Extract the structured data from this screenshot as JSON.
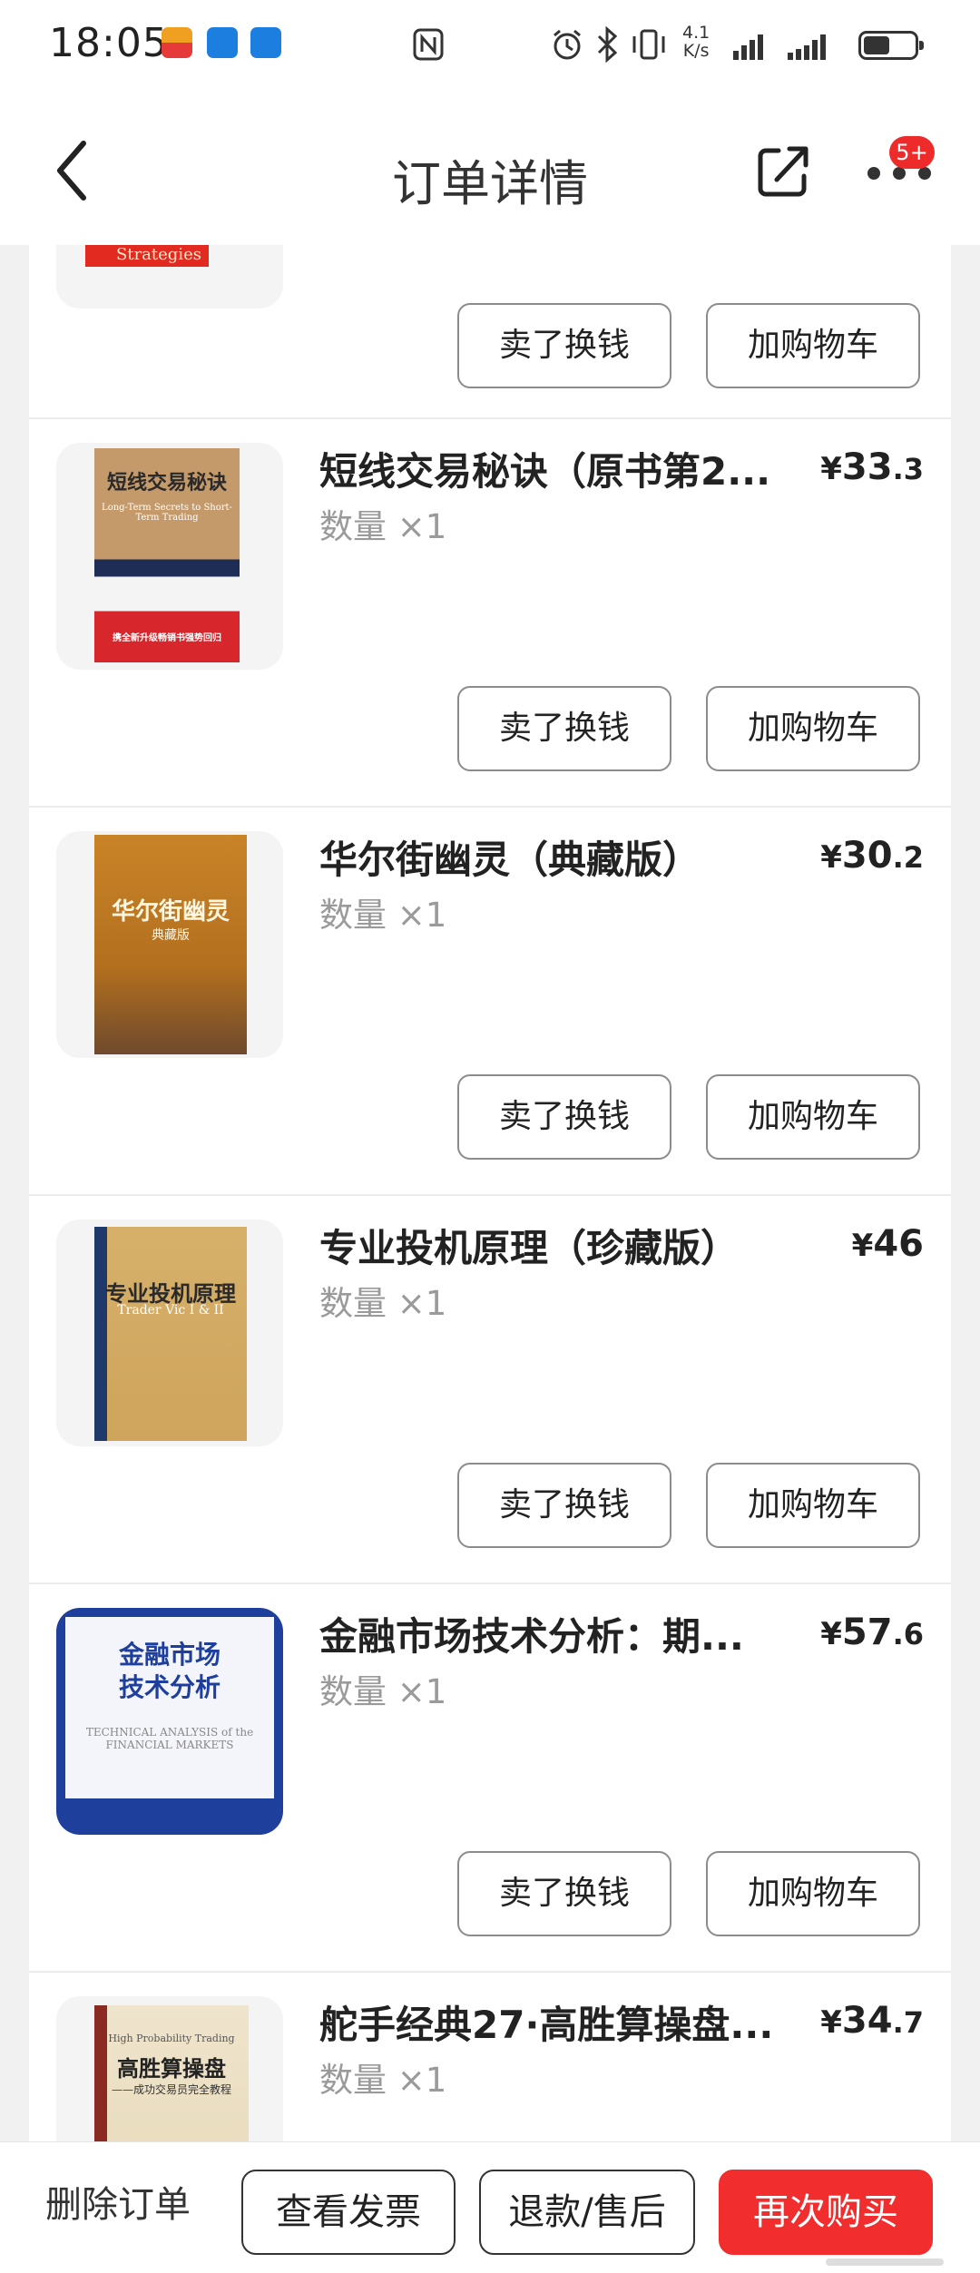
{
  "status_bar": {
    "time": "18:05",
    "network_speed_value": "4.1",
    "network_speed_unit": "K/s",
    "icons": [
      "app-notification-icon",
      "cloud-app-icon",
      "cloud-app-icon",
      "nfc-icon",
      "alarm-icon",
      "bluetooth-icon",
      "vibrate-icon",
      "signal-icon",
      "signal-icon",
      "battery-icon"
    ]
  },
  "nav": {
    "title": "订单详情",
    "badge": "5+"
  },
  "top_partial_item": {
    "cover_text": "Strategies",
    "sell_label": "卖了换钱",
    "cart_label": "加购物车"
  },
  "items": [
    {
      "title": "短线交易秘诀（原书第2...",
      "quantity": "数量 ×1",
      "price_symbol": "¥",
      "price_int": "33",
      "price_dec": ".3",
      "sell_label": "卖了换钱",
      "cart_label": "加购物车",
      "cover": {
        "title": "短线交易秘诀",
        "subtitle": "Long-Term Secrets to Short-Term Trading",
        "bottom": "携全新升级畅销书强势回归"
      }
    },
    {
      "title": "华尔街幽灵（典藏版）",
      "quantity": "数量 ×1",
      "price_symbol": "¥",
      "price_int": "30",
      "price_dec": ".2",
      "sell_label": "卖了换钱",
      "cart_label": "加购物车",
      "cover": {
        "title": "华尔街幽灵",
        "subtitle": "典藏版"
      }
    },
    {
      "title": "专业投机原理（珍藏版）",
      "quantity": "数量 ×1",
      "price_symbol": "¥",
      "price_int": "46",
      "price_dec": "",
      "sell_label": "卖了换钱",
      "cart_label": "加购物车",
      "cover": {
        "title": "专业投机原理",
        "subtitle": "Trader Vic I & II"
      }
    },
    {
      "title": "金融市场技术分析：期...",
      "quantity": "数量 ×1",
      "price_symbol": "¥",
      "price_int": "57",
      "price_dec": ".6",
      "sell_label": "卖了换钱",
      "cart_label": "加购物车",
      "cover": {
        "title_line1": "金融市场",
        "title_line2": "技术分析",
        "subtitle": "TECHNICAL ANALYSIS of the FINANCIAL MARKETS"
      }
    },
    {
      "title": "舵手经典27·高胜算操盘...",
      "quantity": "数量 ×1",
      "price_symbol": "¥",
      "price_int": "34",
      "price_dec": ".7",
      "sell_label": "",
      "cart_label": "",
      "cover": {
        "title": "高胜算操盘",
        "subtitle": "——成功交易员完全教程",
        "top": "High Probability Trading"
      }
    }
  ],
  "bottom_bar": {
    "delete_label": "删除订单",
    "invoice_label": "查看发票",
    "refund_label": "退款/售后",
    "rebuy_label": "再次购买"
  },
  "colors": {
    "accent_red": "#f22d2d",
    "badge_red": "#ee2b2b",
    "page_bg": "#f1f1f1"
  }
}
